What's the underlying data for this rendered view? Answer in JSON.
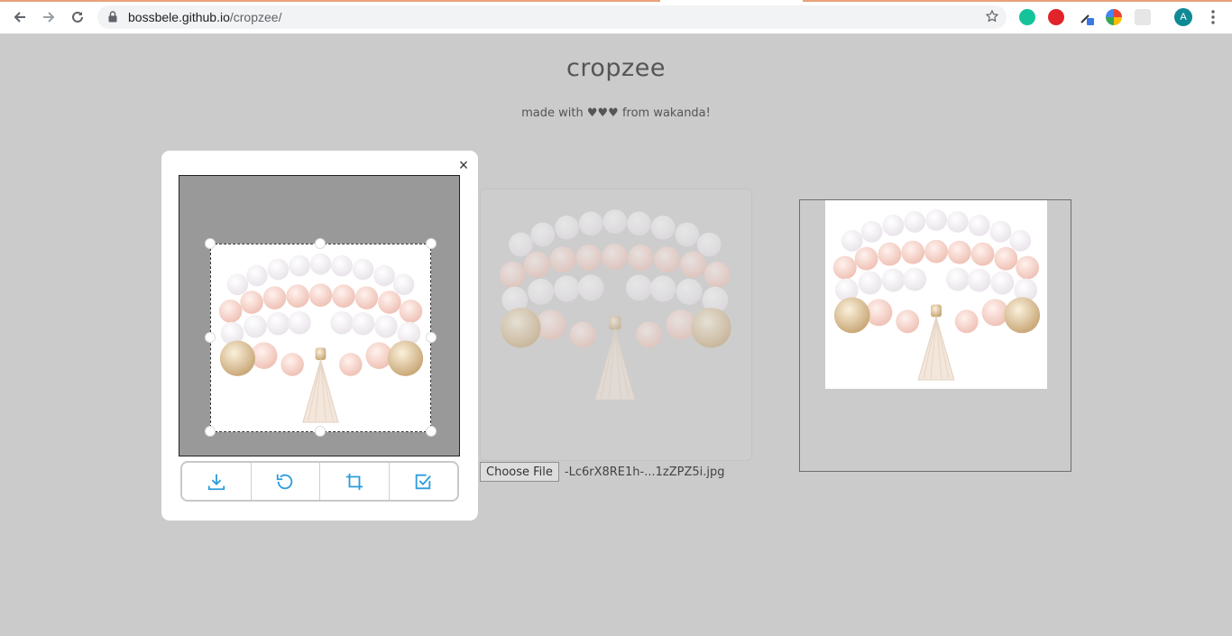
{
  "browser": {
    "url_host": "bossbele.github.io",
    "url_path": "/cropzee/",
    "profile_initial": "A",
    "icons": [
      "back-arrow-icon",
      "forward-arrow-icon",
      "reload-icon",
      "lock-icon",
      "star-icon",
      "grammarly-icon",
      "adblock-icon",
      "eyedropper-icon",
      "chrome-extension-icon",
      "puzzle-icon",
      "kebab-menu-icon"
    ]
  },
  "page": {
    "title": "cropzee",
    "subtitle": "made with ♥♥♥ from wakanda!"
  },
  "modal": {
    "close_label": "×",
    "tools": [
      {
        "icon": "download-icon"
      },
      {
        "icon": "rotate-icon"
      },
      {
        "icon": "crop-icon"
      },
      {
        "icon": "checkbox-icon"
      }
    ]
  },
  "file_input": {
    "button_label": "Choose File",
    "file_name": "-Lc6rX8RE1h-...1zZPZ5i.jpg"
  },
  "colors": {
    "accent_blue": "#2d9cdb",
    "page_bg": "#cbcbcb"
  }
}
